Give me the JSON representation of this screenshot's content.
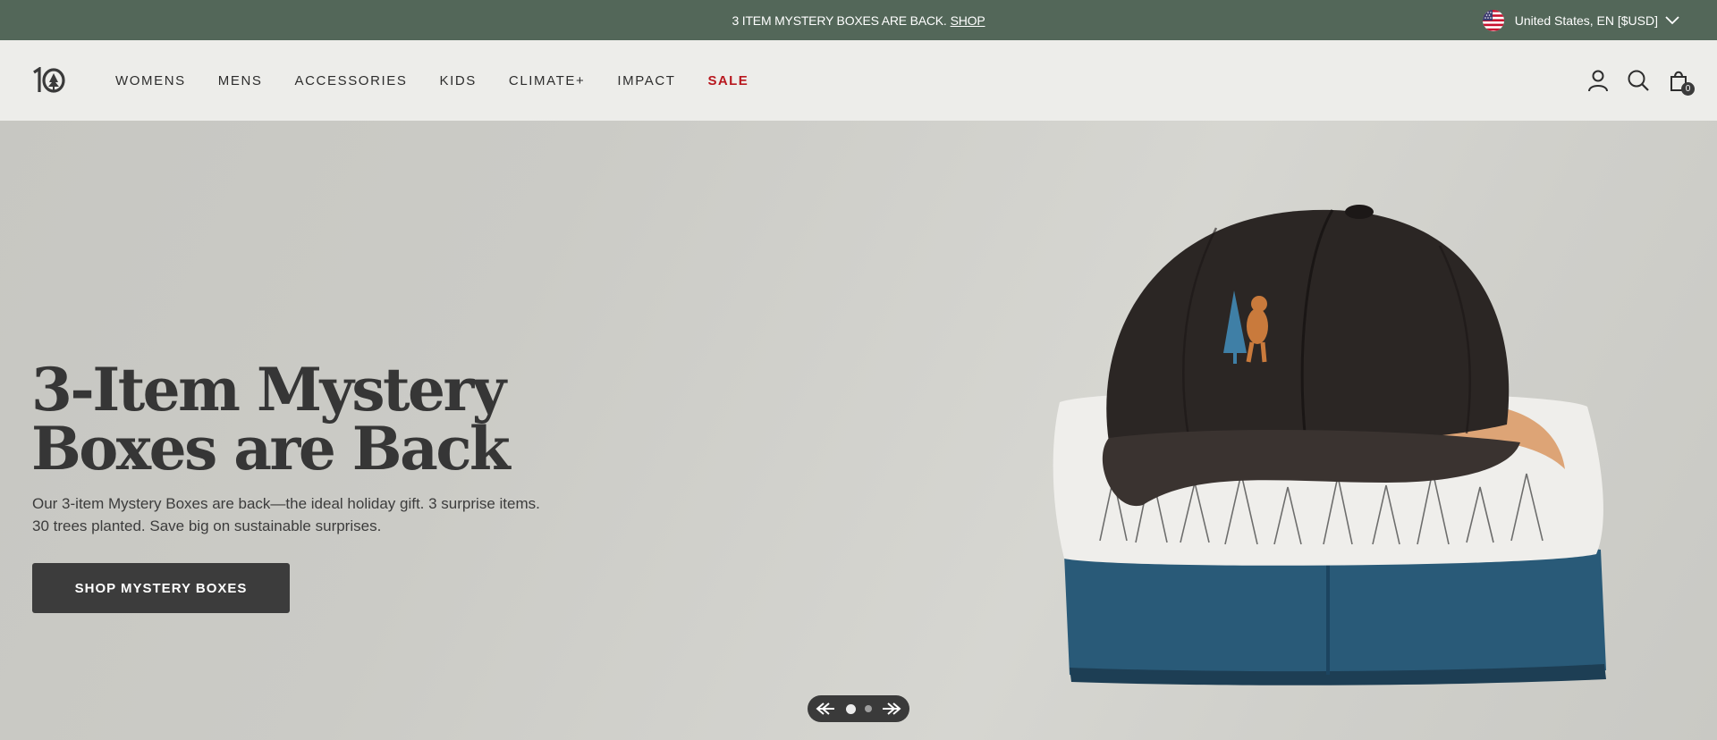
{
  "announcement": {
    "message": "3 ITEM MYSTERY BOXES ARE BACK.",
    "link_label": "SHOP"
  },
  "locale": {
    "label": "United States, EN [$USD]",
    "flag_icon": "us-flag-icon"
  },
  "header": {
    "logo_icon": "tentree-logo-icon",
    "nav": [
      {
        "label": "WOMENS"
      },
      {
        "label": "MENS"
      },
      {
        "label": "ACCESSORIES"
      },
      {
        "label": "KIDS"
      },
      {
        "label": "CLIMATE+"
      },
      {
        "label": "IMPACT"
      },
      {
        "label": "SALE"
      }
    ],
    "icons": [
      "account-icon",
      "search-icon",
      "cart-icon"
    ],
    "cart_count": "0"
  },
  "hero": {
    "title": "3-Item Mystery Boxes are Back",
    "description": "Our 3-item Mystery Boxes are back—the ideal holiday gift. 3 surprise items. 30 trees planted. Save big on sustainable surprises.",
    "cta_label": "SHOP MYSTERY BOXES"
  },
  "slider": {
    "slide_count": 2,
    "active_index": 0
  },
  "colors": {
    "announcement_bg": "#536759",
    "header_bg": "#ededea",
    "sale_red": "#b8181f",
    "button_dark": "#3c3c3c"
  }
}
